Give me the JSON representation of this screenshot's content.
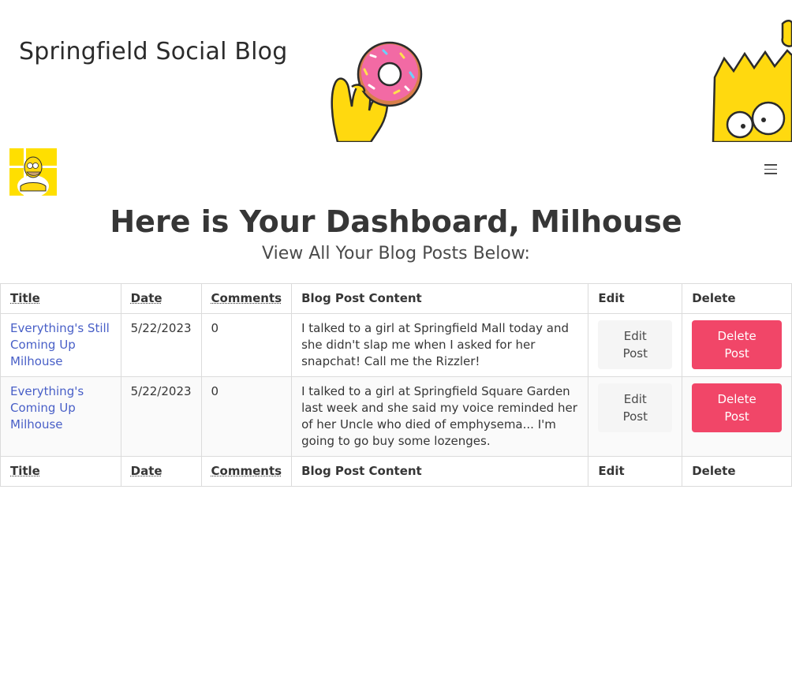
{
  "site": {
    "title": "Springfield Social Blog"
  },
  "nav": {
    "menu_icon": "hamburger-icon",
    "avatar_icon": "homer-avatar"
  },
  "dashboard": {
    "heading": "Here is Your Dashboard, Milhouse",
    "subheading": "View All Your Blog Posts Below:"
  },
  "table": {
    "headers": {
      "title": "Title",
      "date": "Date",
      "comments": "Comments",
      "content": "Blog Post Content",
      "edit": "Edit",
      "delete": "Delete"
    },
    "rows": [
      {
        "title": "Everything's Still Coming Up Milhouse",
        "date": "5/22/2023",
        "comments": "0",
        "content": "I talked to a girl at Springfield Mall today and she didn't slap me when I asked for her snapchat! Call me the Rizzler!",
        "edit_label": "Edit Post",
        "delete_label": "Delete Post"
      },
      {
        "title": "Everything's Coming Up Milhouse",
        "date": "5/22/2023",
        "comments": "0",
        "content": "I talked to a girl at Springfield Square Garden last week and she said my voice reminded her of her Uncle who died of emphysema... I'm going to go buy some lozenges.",
        "edit_label": "Edit Post",
        "delete_label": "Delete Post"
      }
    ]
  },
  "colors": {
    "link": "#485fc7",
    "danger": "#f14668",
    "light": "#f5f5f5"
  }
}
